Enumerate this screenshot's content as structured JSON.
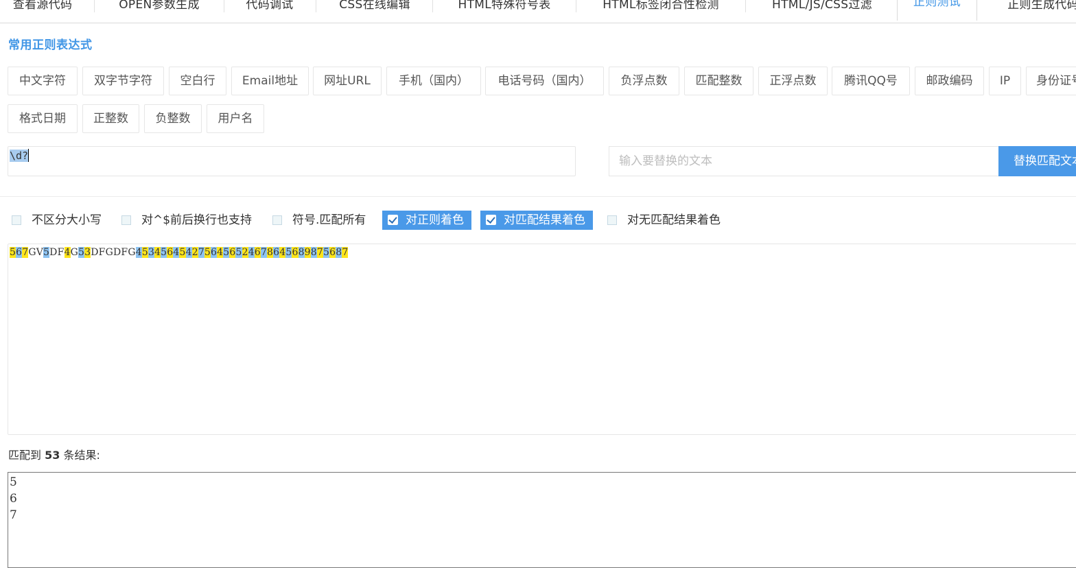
{
  "tabs": [
    {
      "label": "查看源代码"
    },
    {
      "label": "OPEN参数生成"
    },
    {
      "label": "代码调试"
    },
    {
      "label": "CSS在线编辑"
    },
    {
      "label": "HTML特殊符号表"
    },
    {
      "label": "HTML标签闭合性检测"
    },
    {
      "label": "HTML/JS/CSS过滤"
    },
    {
      "label": "正则测试",
      "active": true
    },
    {
      "label": "正则生成代码"
    }
  ],
  "section_title": "常用正则表达式",
  "presets": [
    "中文字符",
    "双字节字符",
    "空白行",
    "Email地址",
    "网址URL",
    "手机（国内）",
    "电话号码（国内）",
    "负浮点数",
    "匹配整数",
    "正浮点数",
    "腾讯QQ号",
    "邮政编码",
    "IP",
    "身份证号",
    "格式日期",
    "正整数",
    "负整数",
    "用户名"
  ],
  "regex_value": "\\d?",
  "replace_placeholder": "输入要替换的文本",
  "replace_button": "替换匹配文本",
  "options": [
    {
      "label": "不区分大小写",
      "checked": false
    },
    {
      "label": "对^$前后换行也支持",
      "checked": false
    },
    {
      "label": "符号.匹配所有",
      "checked": false
    },
    {
      "label": "对正则着色",
      "checked": true
    },
    {
      "label": "对匹配结果着色",
      "checked": true
    },
    {
      "label": "对无匹配结果着色",
      "checked": false
    }
  ],
  "test_text": "567GV5DF4G53DFGDFG45345645427564565246786456898756​87",
  "result": {
    "prefix": "匹配到",
    "count": "53",
    "suffix": "条结果:",
    "items": [
      "5",
      "6",
      "7"
    ]
  },
  "colors": {
    "accent": "#4196e6",
    "match_yellow": "#ffe51a",
    "match_blue": "#8dc3f2",
    "button_blue": "#4a99e8"
  }
}
